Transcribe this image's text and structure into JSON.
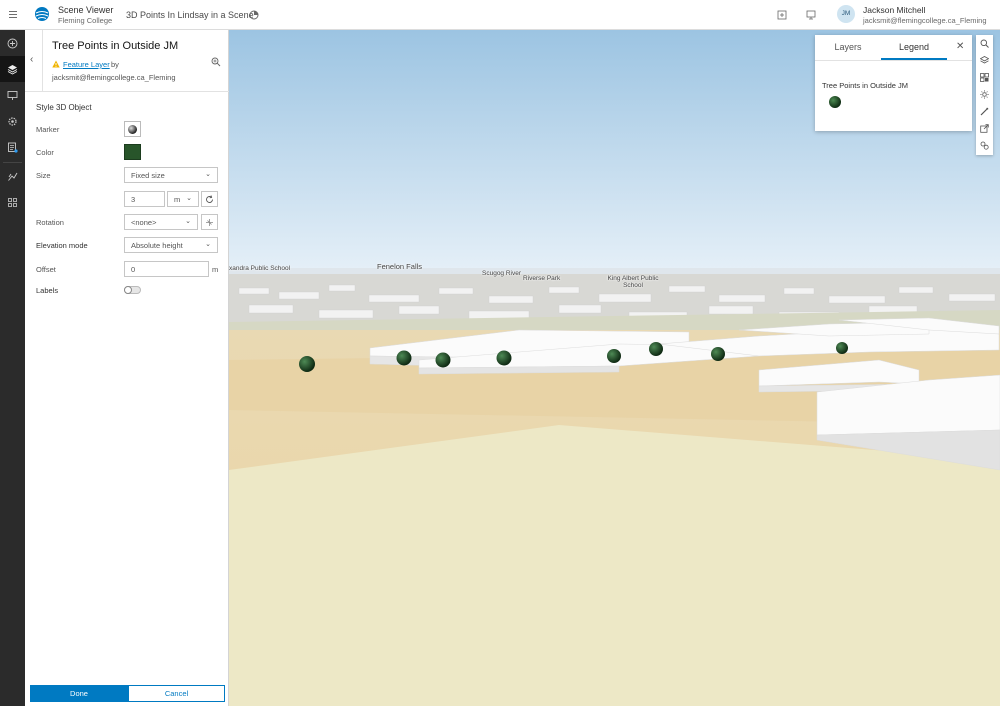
{
  "header": {
    "app_title": "Scene Viewer",
    "org": "Fleming College",
    "scene_title": "3D Points In Lindsay in a Scene",
    "user": {
      "initials": "JM",
      "name": "Jackson Mitchell",
      "email": "jacksmit@flemingcollege.ca_Fleming"
    }
  },
  "panel": {
    "title": "Tree Points in Outside JM",
    "source_link": "Feature Layer",
    "by": "by",
    "owner": "jacksmit@flemingcollege.ca_Fleming",
    "section_title": "Style 3D Object",
    "marker_label": "Marker",
    "color_label": "Color",
    "color_value": "#28552a",
    "size_label": "Size",
    "size_mode": "Fixed size",
    "size_value": "3",
    "size_unit": "m",
    "rotation_label": "Rotation",
    "rotation_value": "<none>",
    "elevation_label": "Elevation mode",
    "elevation_value": "Absolute height",
    "offset_label": "Offset",
    "offset_value": "0",
    "offset_unit": "m",
    "labels_label": "Labels",
    "labels_on": false,
    "done_label": "Done",
    "cancel_label": "Cancel"
  },
  "map": {
    "labels": [
      "xandra Public School",
      "Fenelon Falls",
      "Scugog River",
      "Riverse Park",
      "King Albert Public School"
    ]
  },
  "legend": {
    "tab_layers": "Layers",
    "tab_legend": "Legend",
    "active_tab": "Legend",
    "layer_name": "Tree Points in Outside JM"
  },
  "icons": {
    "right_toolbar": [
      "search-icon",
      "layers-icon",
      "basemap-icon",
      "daylight-icon",
      "measure-icon",
      "share-icon",
      "settings-icon"
    ],
    "left_bar": [
      "add-icon",
      "layers-icon",
      "presentation-icon",
      "settings-icon",
      "table-icon",
      "analysis-icon",
      "apps-icon"
    ]
  }
}
